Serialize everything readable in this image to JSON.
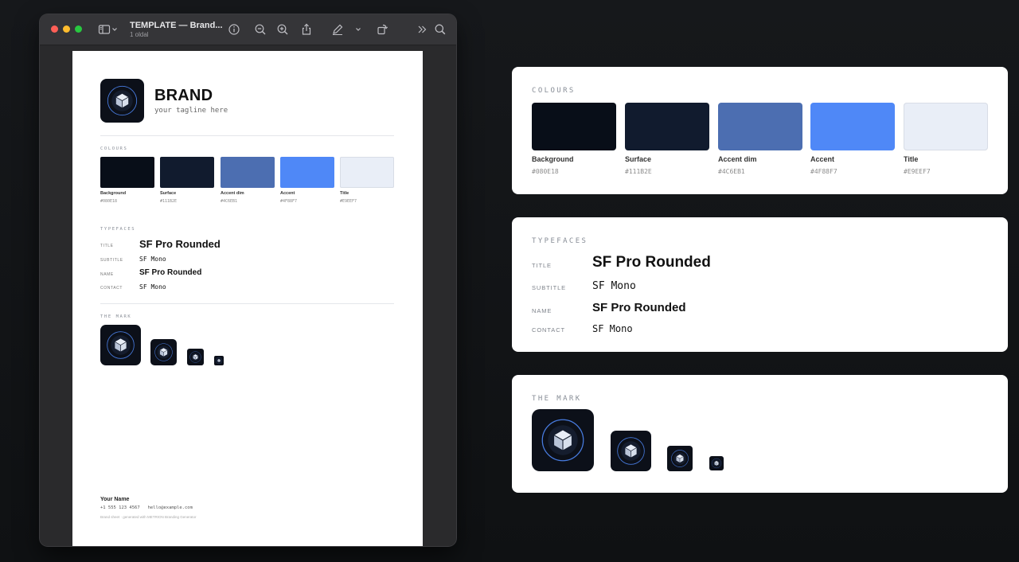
{
  "window": {
    "title": "TEMPLATE — Brand...",
    "subtitle": "1 oldal",
    "toolbar_icons": [
      "sidebar-icon",
      "chevron-down-icon",
      "info-icon",
      "zoom-out-icon",
      "zoom-in-icon",
      "share-icon",
      "markup-pen-icon",
      "chevron-down-icon",
      "rotate-icon",
      "more-chevron-icon",
      "search-icon"
    ]
  },
  "brand": {
    "name": "BRAND",
    "tagline": "your tagline here"
  },
  "sections": {
    "colours": "COLOURS",
    "typefaces": "TYPEFACES",
    "mark": "THE MARK"
  },
  "colours": [
    {
      "name": "Background",
      "hex": "#080E18",
      "color": "#080E18"
    },
    {
      "name": "Surface",
      "hex": "#111B2E",
      "color": "#111B2E"
    },
    {
      "name": "Accent dim",
      "hex": "#4C6EB1",
      "color": "#4C6EB1"
    },
    {
      "name": "Accent",
      "hex": "#4F88F7",
      "color": "#4F88F7"
    },
    {
      "name": "Title",
      "hex": "#E9EEF7",
      "color": "#E9EEF7"
    }
  ],
  "typefaces": [
    {
      "label": "TITLE",
      "value": "SF Pro Rounded"
    },
    {
      "label": "SUBTITLE",
      "value": "SF Mono"
    },
    {
      "label": "NAME",
      "value": "SF Pro Rounded"
    },
    {
      "label": "CONTACT",
      "value": "SF Mono"
    }
  ],
  "contact": {
    "name": "Your Name",
    "phone": "+1 555 123 4567",
    "email": "hello@example.com"
  },
  "footer": "Brand sheet · generated with METRION Branding Generator",
  "logo_icon": "cube-in-circle-logo-icon"
}
